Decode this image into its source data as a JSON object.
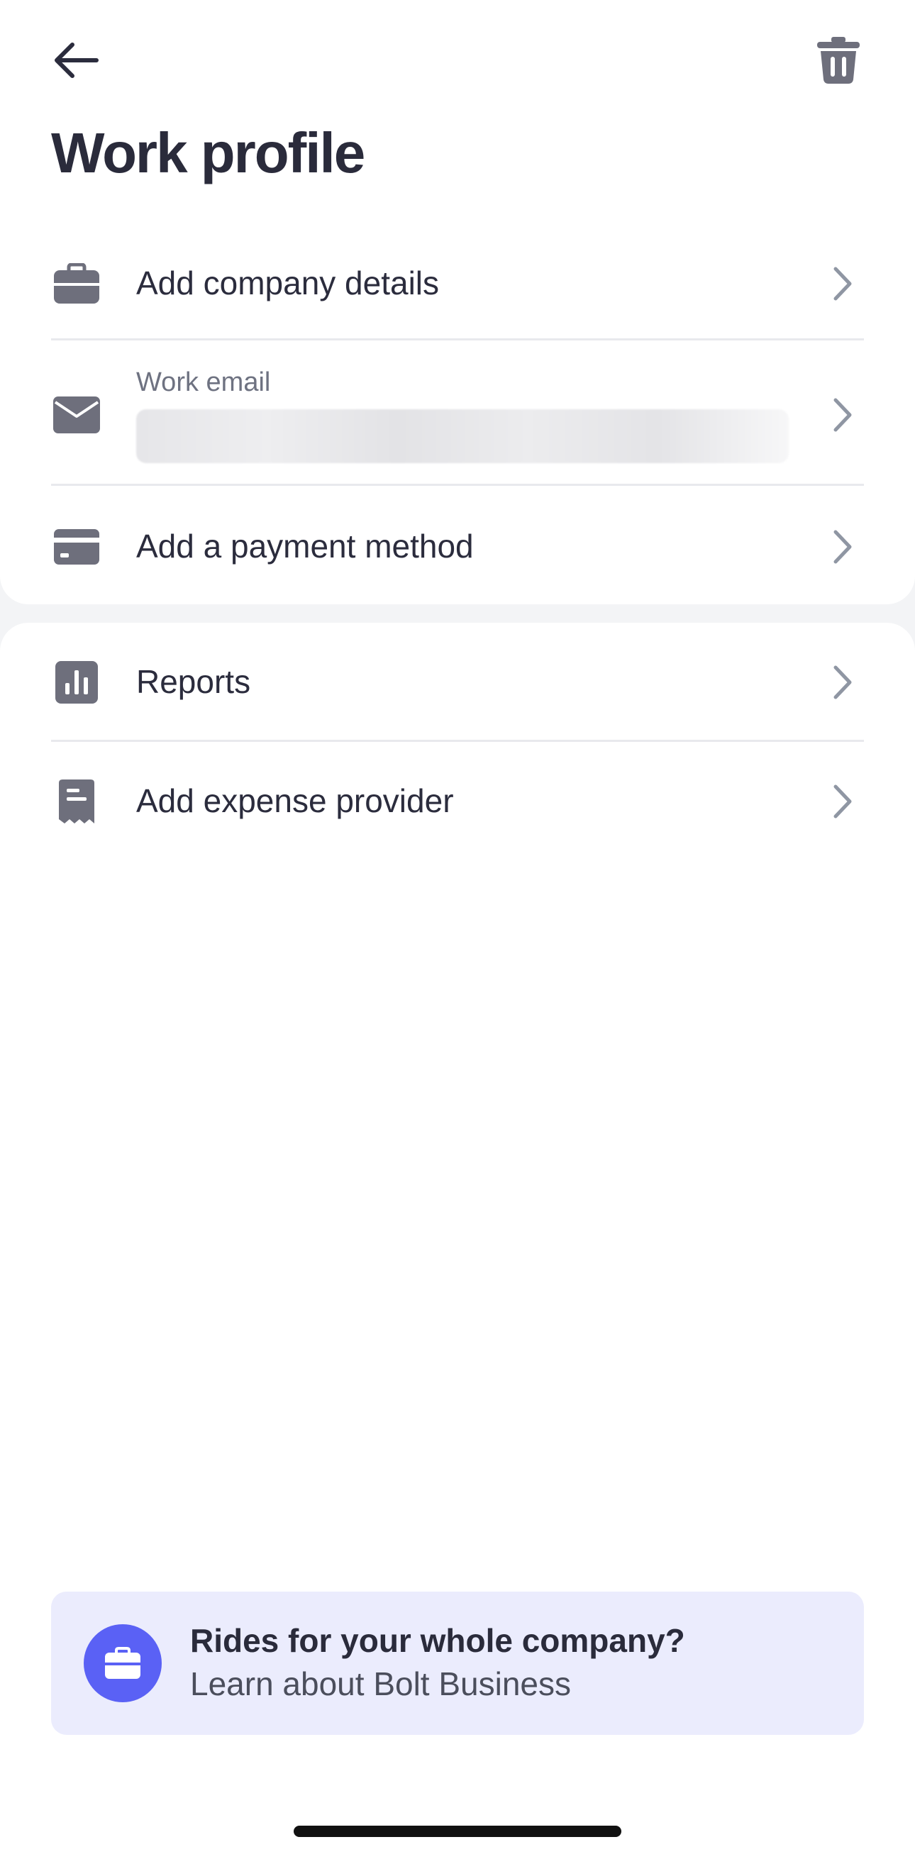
{
  "header": {
    "title": "Work profile",
    "back_icon": "arrow-left-icon",
    "delete_icon": "trash-icon"
  },
  "profile_section": {
    "items": [
      {
        "label": "Add company details",
        "icon": "briefcase-icon"
      },
      {
        "sublabel": "Work email",
        "icon": "envelope-icon"
      },
      {
        "label": "Add a payment method",
        "icon": "credit-card-icon"
      }
    ]
  },
  "tools_section": {
    "items": [
      {
        "label": "Reports",
        "icon": "bar-chart-icon"
      },
      {
        "label": "Add expense provider",
        "icon": "receipt-icon"
      }
    ]
  },
  "promo": {
    "title": "Rides for your whole company?",
    "subtitle": "Learn about Bolt Business",
    "icon": "briefcase-icon",
    "accent_color": "#5a61f5",
    "background_color": "#ebecfd"
  },
  "colors": {
    "text_primary": "#2b2c3d",
    "icon_gray": "#6e6f7c",
    "chevron_gray": "#8f96a3"
  }
}
